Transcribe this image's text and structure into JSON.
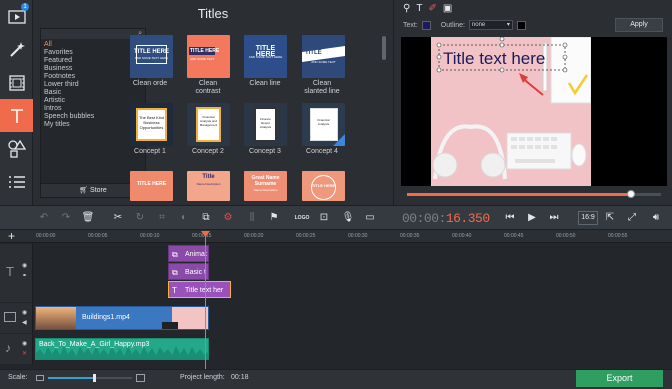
{
  "window": {
    "badge_count": "1"
  },
  "titles_panel": {
    "heading": "Titles",
    "categories": [
      "All",
      "Favorites",
      "Featured",
      "Business",
      "Footnotes",
      "Lower third",
      "Basic",
      "Artistic",
      "Intros",
      "Speech bubbles",
      "My titles"
    ],
    "selected_category": "All",
    "store_label": "Store",
    "thumbnails": [
      {
        "label": "Clean orde",
        "caption": "TITLE HERE",
        "sub": "AND SOME TEXT HERE"
      },
      {
        "label": "Clean\ncontrast",
        "caption": "TITLE HERE",
        "sub": "AND SOME TEXT"
      },
      {
        "label": "Clean line",
        "caption": "TITLE HERE",
        "sub": "AND SOME TEXT HERE"
      },
      {
        "label": "Clean\nslanted line",
        "caption": "TITLE",
        "sub": "AND SOME TEXT"
      },
      {
        "label": "Concept 1",
        "caption": "The Best Kind Business Opportunities"
      },
      {
        "label": "Concept 2",
        "caption": "Financial Analysis and Management"
      },
      {
        "label": "Concept 3",
        "caption": "Finance Report Analysis"
      },
      {
        "label": "Concept 4",
        "caption": "Financial Analysis"
      },
      {
        "label": "",
        "caption": "TITLE HERE"
      },
      {
        "label": "",
        "caption": "Title",
        "sub": "Name Description"
      },
      {
        "label": "",
        "caption": "Great Name Surname",
        "sub": "Name Description"
      },
      {
        "label": "",
        "caption": "TITLE HERE"
      }
    ]
  },
  "preview": {
    "text_label": "Text:",
    "outline_label": "Outline:",
    "outline_value": "none",
    "apply_label": "Apply",
    "title_text": "Title text here",
    "text_color": "#1b1b5a",
    "outline_color": "#000000",
    "playback_fraction": 0.88
  },
  "toolbar": {
    "timecode_dim": "00:00:",
    "timecode_hot": "16.350",
    "aspect_label": "16:9",
    "logo_label": "LOGO"
  },
  "timeline": {
    "ticks": [
      "00:00:00",
      "00:00:05",
      "00:00:10",
      "00:00:15",
      "00:00:20",
      "00:00:25",
      "00:00:30",
      "00:00:35",
      "00:00:40",
      "00:00:45",
      "00:00:50",
      "00:00:55"
    ],
    "title_clips": [
      {
        "label": "Animat"
      },
      {
        "label": "Basic t"
      },
      {
        "label": "Title text her"
      }
    ],
    "video_clip": "Buildings1.mp4",
    "audio_clip": "Back_To_Make_A_Girl_Happy.mp3"
  },
  "status": {
    "scale_label": "Scale:",
    "scale_fraction": 0.55,
    "project_length_label": "Project length:",
    "project_length": "00:18",
    "export_label": "Export"
  },
  "colors": {
    "accent": "#f06b4b",
    "export": "#2e9e61",
    "title_clip": "#8a4aa8",
    "audio": "#23a88a",
    "video": "#3b78c2"
  }
}
